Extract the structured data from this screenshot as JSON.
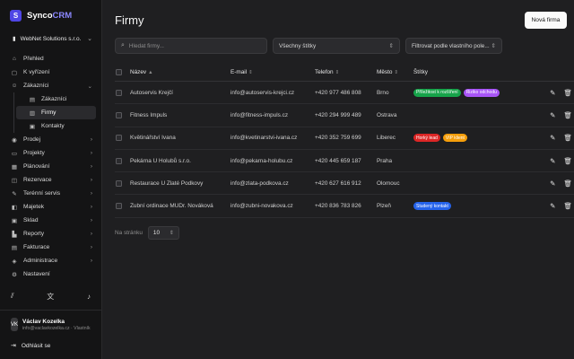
{
  "brand": {
    "logo_letter": "S",
    "name_a": "Synco",
    "name_b": "CRM",
    "accent": "#4f46e5"
  },
  "org": {
    "name": "WebNet Solutions s.r.o."
  },
  "nav": {
    "prehled": "Přehled",
    "k_vyrizeni": "K vyřízení",
    "zakaznici": "Zákazníci",
    "sub": {
      "zakaznici": "Zákazníci",
      "firmy": "Firmy",
      "kontakty": "Kontakty"
    },
    "prodej": "Prodej",
    "projekty": "Projekty",
    "planovani": "Plánování",
    "rezervace": "Rezervace",
    "terenni": "Terénní servis",
    "majetek": "Majetek",
    "sklad": "Sklad",
    "reporty": "Reporty",
    "fakturace": "Fakturace",
    "administrace": "Administrace",
    "nastaveni": "Nastavení"
  },
  "user": {
    "initials": "VK",
    "name": "Václav Kozelka",
    "email": "info@vaclavkozelka.cz · Vlastník"
  },
  "logout": "Odhlásit se",
  "page": {
    "title": "Firmy",
    "new_button": "Nová firma"
  },
  "filters": {
    "search_placeholder": "Hledat firmy...",
    "tags_select": "Všechny štítky",
    "field_select": "Filtrovat podle vlastního pole..."
  },
  "table": {
    "headers": {
      "name": "Název",
      "email": "E-mail",
      "phone": "Telefon",
      "city": "Město",
      "tags": "Štítky"
    },
    "rows": [
      {
        "name": "Autoservis Krejčí",
        "email": "info@autoservis-krejci.cz",
        "phone": "+420 977 486 808",
        "city": "Brno",
        "tags": [
          {
            "label": "Příležitost k rozšíření",
            "color": "#16a34a"
          },
          {
            "label": "Riziko odchodu",
            "color": "#a855f7"
          }
        ]
      },
      {
        "name": "Fitness Impuls",
        "email": "info@fitness-impuls.cz",
        "phone": "+420 294 999 489",
        "city": "Ostrava",
        "tags": []
      },
      {
        "name": "Květinářství Ivana",
        "email": "info@kvetinarstvi-ivana.cz",
        "phone": "+420 352 759 699",
        "city": "Liberec",
        "tags": [
          {
            "label": "Horký lead",
            "color": "#dc2626"
          },
          {
            "label": "VIP klient",
            "color": "#f59e0b"
          }
        ]
      },
      {
        "name": "Pekárna U Holubů s.r.o.",
        "email": "info@pekarna-holubu.cz",
        "phone": "+420 445 659 187",
        "city": "Praha",
        "tags": []
      },
      {
        "name": "Restaurace U Zlaté Podkovy",
        "email": "info@zlata-podkova.cz",
        "phone": "+420 627 616 912",
        "city": "Olomouc",
        "tags": []
      },
      {
        "name": "Zubní ordinace MUDr. Nováková",
        "email": "info@zubni-novakova.cz",
        "phone": "+420 836 783 826",
        "city": "Plzeň",
        "tags": [
          {
            "label": "Studený kontakt",
            "color": "#2563eb"
          }
        ]
      }
    ]
  },
  "pager": {
    "label": "Na stránku",
    "value": "10"
  }
}
